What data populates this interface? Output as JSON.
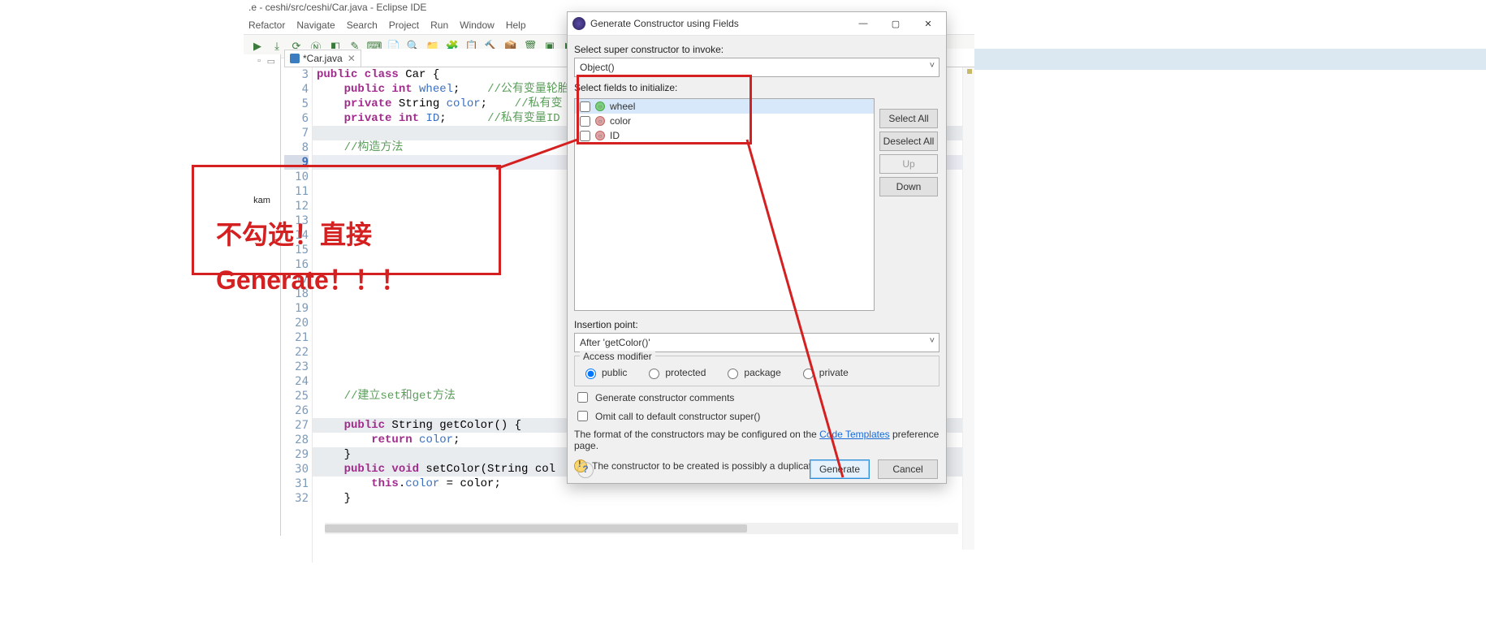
{
  "eclipse": {
    "title": ".e - ceshi/src/ceshi/Car.java - Eclipse IDE",
    "menus": [
      "Refactor",
      "Navigate",
      "Search",
      "Project",
      "Run",
      "Window",
      "Help"
    ],
    "tab_label": "*Car.java",
    "kam": "kam",
    "code": {
      "lines": [
        {
          "n": 3,
          "html": "<span class='kw'>public class</span> Car {"
        },
        {
          "n": 4,
          "html": "    <span class='kw'>public int</span> <span class='name'>wheel</span>;    <span class='cmt'>//公有变量轮胎</span>"
        },
        {
          "n": 5,
          "html": "    <span class='kw'>private</span> String <span class='name'>color</span>;    <span class='cmt'>//私有变</span>"
        },
        {
          "n": 6,
          "html": "    <span class='kw'>private int</span> <span class='name'>ID</span>;      <span class='cmt'>//私有变量ID</span>"
        },
        {
          "n": 7,
          "html": ""
        },
        {
          "n": 8,
          "html": "    <span class='cmt'>//构造方法</span>"
        },
        {
          "n": 9,
          "html": ""
        },
        {
          "n": 10,
          "html": ""
        },
        {
          "n": 11,
          "html": ""
        },
        {
          "n": 12,
          "html": ""
        },
        {
          "n": 13,
          "html": ""
        },
        {
          "n": 14,
          "html": ""
        },
        {
          "n": 15,
          "html": ""
        },
        {
          "n": 16,
          "html": ""
        },
        {
          "n": 17,
          "html": ""
        },
        {
          "n": 18,
          "html": ""
        },
        {
          "n": 19,
          "html": ""
        },
        {
          "n": 20,
          "html": ""
        },
        {
          "n": 21,
          "html": ""
        },
        {
          "n": 22,
          "html": ""
        },
        {
          "n": 23,
          "html": ""
        },
        {
          "n": 24,
          "html": ""
        },
        {
          "n": 25,
          "html": "    <span class='cmt'>//建立set和get方法</span>"
        },
        {
          "n": 26,
          "html": ""
        },
        {
          "n": 27,
          "html": "    <span class='kw'>public</span> String getColor() {"
        },
        {
          "n": 28,
          "html": "        <span class='kw'>return</span> <span class='name'>color</span>;"
        },
        {
          "n": 29,
          "html": "    }"
        },
        {
          "n": 30,
          "html": "    <span class='kw'>public void</span> setColor(String col"
        },
        {
          "n": 31,
          "html": "        <span class='this'>this</span>.<span class='name'>color</span> = color;"
        },
        {
          "n": 32,
          "html": "    }"
        }
      ],
      "active_line": 9
    }
  },
  "dialog": {
    "title": "Generate Constructor using Fields",
    "select_super_label": "Select super constructor to invoke:",
    "super_value": "Object()",
    "select_fields_label": "Select fields to initialize:",
    "fields": [
      {
        "name": "wheel",
        "checked": false,
        "vis": "green",
        "selected": true
      },
      {
        "name": "color",
        "checked": false,
        "vis": "red",
        "selected": false
      },
      {
        "name": "ID",
        "checked": false,
        "vis": "red",
        "selected": false
      }
    ],
    "side_buttons": {
      "select_all": "Select All",
      "deselect_all": "Deselect All",
      "up": "Up",
      "down": "Down"
    },
    "insertion_label": "Insertion point:",
    "insertion_value": "After 'getColor()'",
    "access_modifier_legend": "Access modifier",
    "radios": [
      {
        "id": "public",
        "label": "public",
        "checked": true
      },
      {
        "id": "protected",
        "label": "protected",
        "checked": false
      },
      {
        "id": "package",
        "label": "package",
        "checked": false
      },
      {
        "id": "private",
        "label": "private",
        "checked": false
      }
    ],
    "gen_comments": "Generate constructor comments",
    "omit_super": "Omit call to default constructor super()",
    "templates_note_pre": "The format of the constructors may be configured on the ",
    "templates_link": "Code Templates",
    "templates_note_post": " preference page.",
    "warning": "The constructor to be created is possibly a duplicate",
    "generate": "Generate",
    "cancel": "Cancel",
    "help_tooltip": "?"
  },
  "annotation": {
    "line1": "不勾选！直接",
    "line2": "Generate！！！"
  }
}
